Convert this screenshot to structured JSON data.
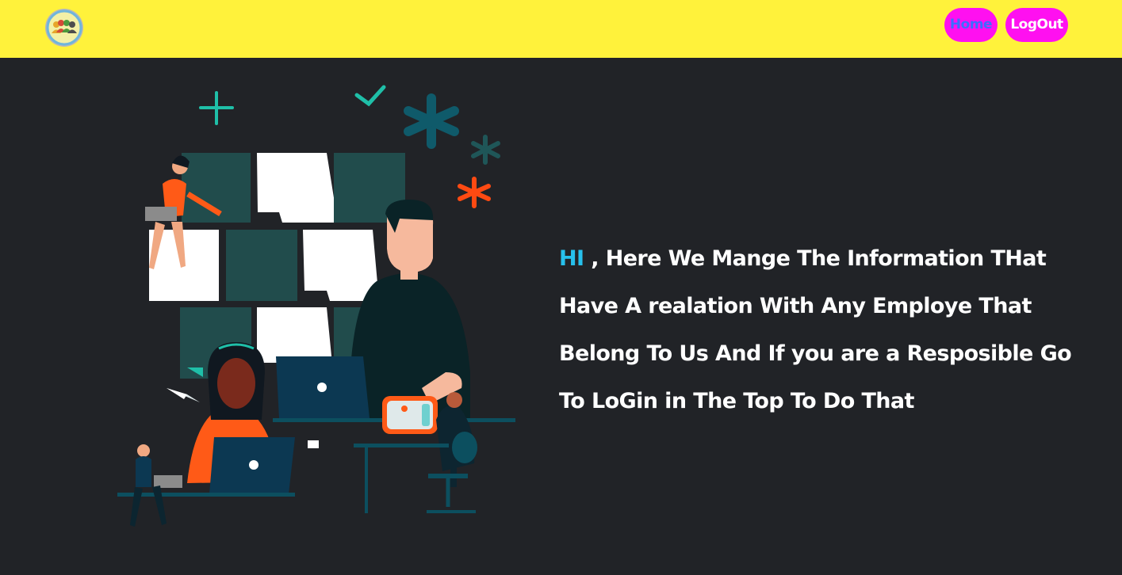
{
  "navbar": {
    "home_label": "Home",
    "logout_label": "LogOut",
    "logo_icon": "team-logo-icon",
    "background_color": "#fff23b",
    "button_color": "#ff10f0"
  },
  "hero": {
    "greeting": "HI",
    "message": " , Here We Mange The Information THat Have A realation With Any Employe That Belong To Us And If you are a Resposible Go To LoGin in The Top To Do That",
    "greeting_color": "#27c0ec",
    "background_color": "#212327",
    "illustration_icon": "office-team-illustration"
  }
}
